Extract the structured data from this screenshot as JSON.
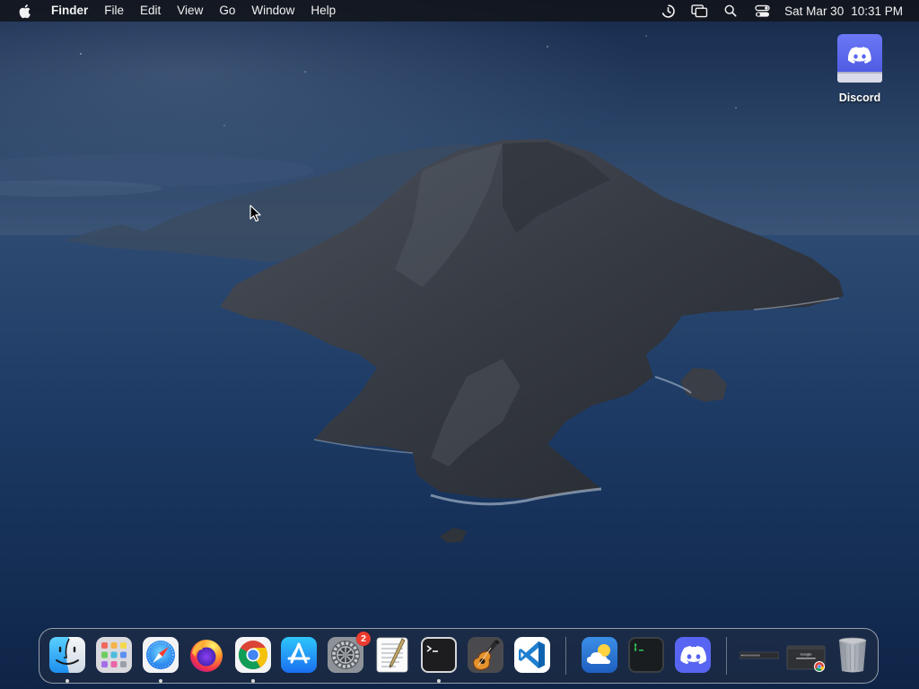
{
  "menubar": {
    "app_name": "Finder",
    "items": [
      "File",
      "Edit",
      "View",
      "Go",
      "Window",
      "Help"
    ],
    "clock": {
      "date": "Sat Mar 30",
      "time": "10:31 PM"
    },
    "status_icons": [
      "screen-time-icon",
      "screen-mirroring-icon",
      "spotlight-search-icon",
      "control-center-icon"
    ]
  },
  "desktop": {
    "icons": [
      {
        "label": "Discord",
        "icon": "discord-disk-icon"
      }
    ]
  },
  "dock": {
    "apps": [
      {
        "name": "Finder",
        "icon": "finder-icon",
        "running": true
      },
      {
        "name": "Launchpad",
        "icon": "launchpad-icon",
        "running": false
      },
      {
        "name": "Safari",
        "icon": "safari-icon",
        "running": true
      },
      {
        "name": "Firefox",
        "icon": "firefox-icon",
        "running": false
      },
      {
        "name": "Google Chrome",
        "icon": "chrome-icon",
        "running": true
      },
      {
        "name": "App Store",
        "icon": "app-store-icon",
        "running": false
      },
      {
        "name": "System Preferences",
        "icon": "system-preferences-icon",
        "running": false,
        "badge": "2"
      },
      {
        "name": "TextEdit",
        "icon": "textedit-icon",
        "running": false
      },
      {
        "name": "Terminal",
        "icon": "terminal-icon",
        "running": true
      },
      {
        "name": "GarageBand",
        "icon": "garageband-icon",
        "running": false
      },
      {
        "name": "Visual Studio Code",
        "icon": "vscode-icon",
        "running": false
      },
      {
        "name": "Weather",
        "icon": "weather-icon",
        "running": false
      },
      {
        "name": "Terminal",
        "icon": "terminal-green-icon",
        "running": false
      },
      {
        "name": "Discord",
        "icon": "discord-icon",
        "running": false
      }
    ],
    "minimized": [
      {
        "icon": "minimized-window-icon"
      },
      {
        "icon": "minimized-chrome-window-icon",
        "mini_text": "Google"
      }
    ],
    "trash": {
      "icon": "trash-icon"
    }
  },
  "colors": {
    "menubar_bg": "#12141a",
    "badge": "#ec3b2f",
    "discord_blurple": "#5865f2",
    "wallpaper_sky": "#1d3354",
    "wallpaper_sea": "#143057"
  }
}
